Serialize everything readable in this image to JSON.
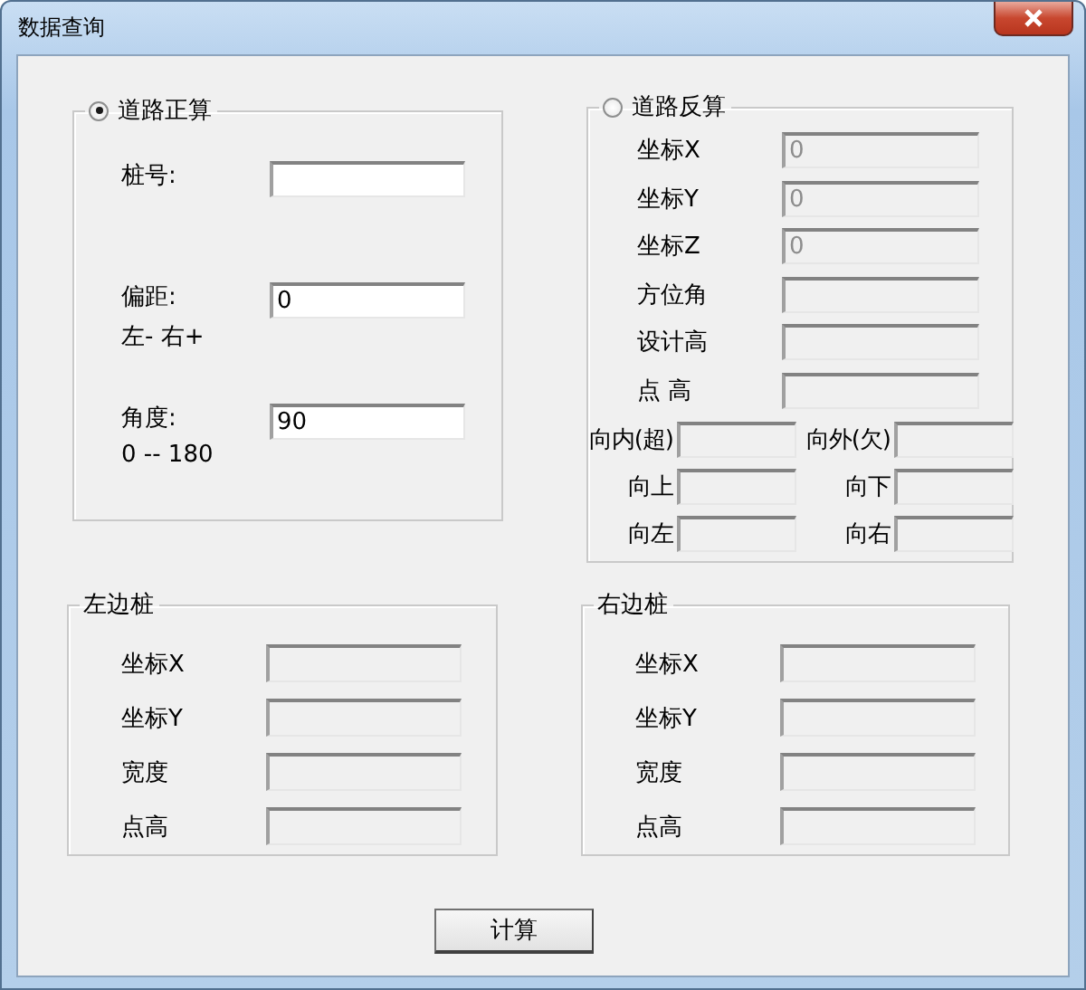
{
  "window": {
    "title": "数据查询"
  },
  "forward": {
    "label": "道路正算",
    "selected": true,
    "rows": [
      {
        "label": "桩号:",
        "disabled": false
      },
      {
        "label": "偏距:",
        "note": "左- 右+",
        "value": "0",
        "disabled": false
      },
      {
        "label": "角度:",
        "note": "0 -- 180",
        "value": "90",
        "disabled": false
      }
    ]
  },
  "reverse": {
    "label": "道路反算",
    "selected": false,
    "rows": [
      {
        "label": "坐标X",
        "value": "0",
        "disabled": true
      },
      {
        "label": "坐标Y",
        "value": "0",
        "disabled": true
      },
      {
        "label": "坐标Z",
        "value": "0",
        "disabled": true
      },
      {
        "label": "方位角",
        "disabled": true
      },
      {
        "label": "设计高",
        "disabled": true
      },
      {
        "label": "点 高",
        "disabled": true
      }
    ],
    "offsets": [
      {
        "label": "向内(超)",
        "disabled": true
      },
      {
        "label": "向外(欠)",
        "disabled": true
      },
      {
        "label": "向上",
        "disabled": true
      },
      {
        "label": "向下",
        "disabled": true
      },
      {
        "label": "向左",
        "disabled": true
      },
      {
        "label": "向右",
        "disabled": true
      }
    ]
  },
  "left_stake": {
    "label": "左边桩",
    "rows": [
      {
        "label": "坐标X",
        "disabled": true
      },
      {
        "label": "坐标Y",
        "disabled": true
      },
      {
        "label": "宽度",
        "disabled": true
      },
      {
        "label": "点高",
        "disabled": true
      }
    ]
  },
  "right_stake": {
    "label": "右边桩",
    "rows": [
      {
        "label": "坐标X",
        "disabled": true
      },
      {
        "label": "坐标Y",
        "disabled": true
      },
      {
        "label": "宽度",
        "disabled": true
      },
      {
        "label": "点高",
        "disabled": true
      }
    ]
  },
  "button": {
    "label": "计算"
  }
}
